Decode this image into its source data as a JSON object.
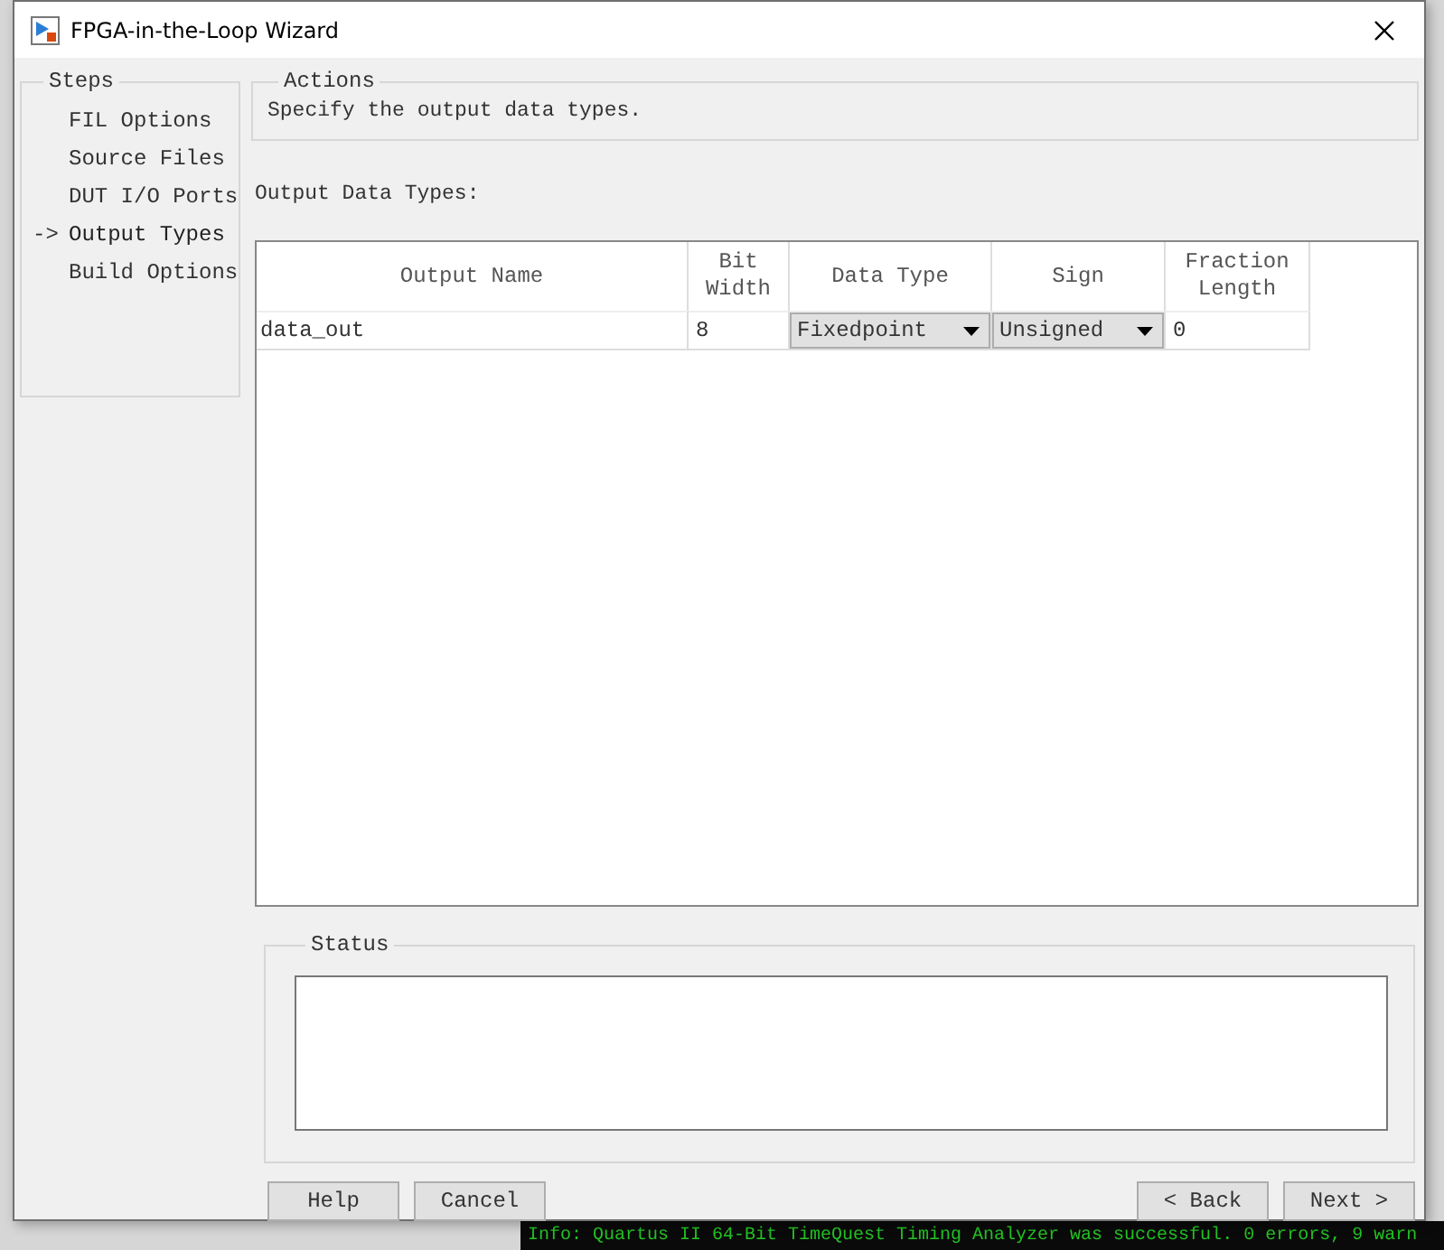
{
  "window": {
    "title": "FPGA-in-the-Loop Wizard"
  },
  "steps": {
    "title": "Steps",
    "current_marker": "->",
    "items": [
      {
        "label": "FIL Options",
        "selected": false
      },
      {
        "label": "Source Files",
        "selected": false
      },
      {
        "label": "DUT I/O Ports",
        "selected": false
      },
      {
        "label": "Output Types",
        "selected": true
      },
      {
        "label": "Build Options",
        "selected": false
      }
    ]
  },
  "actions": {
    "title": "Actions",
    "text": "Specify the output data types."
  },
  "section_label": "Output Data Types:",
  "table": {
    "columns": [
      {
        "label": "Output Name",
        "kind": "text"
      },
      {
        "label": "Bit\nWidth",
        "kind": "text"
      },
      {
        "label": "Data Type",
        "kind": "dropdown"
      },
      {
        "label": "Sign",
        "kind": "dropdown"
      },
      {
        "label": "Fraction\nLength",
        "kind": "text"
      }
    ],
    "rows": [
      [
        "data_out",
        "8",
        "Fixedpoint",
        "Unsigned",
        "0"
      ]
    ]
  },
  "status": {
    "title": "Status"
  },
  "buttons": {
    "left": [
      "Help",
      "Cancel"
    ],
    "right": [
      "< Back",
      "Next >"
    ]
  },
  "console": {
    "line": "Info: Quartus II 64-Bit TimeQuest Timing Analyzer was successful. 0 errors, 9 warn"
  }
}
